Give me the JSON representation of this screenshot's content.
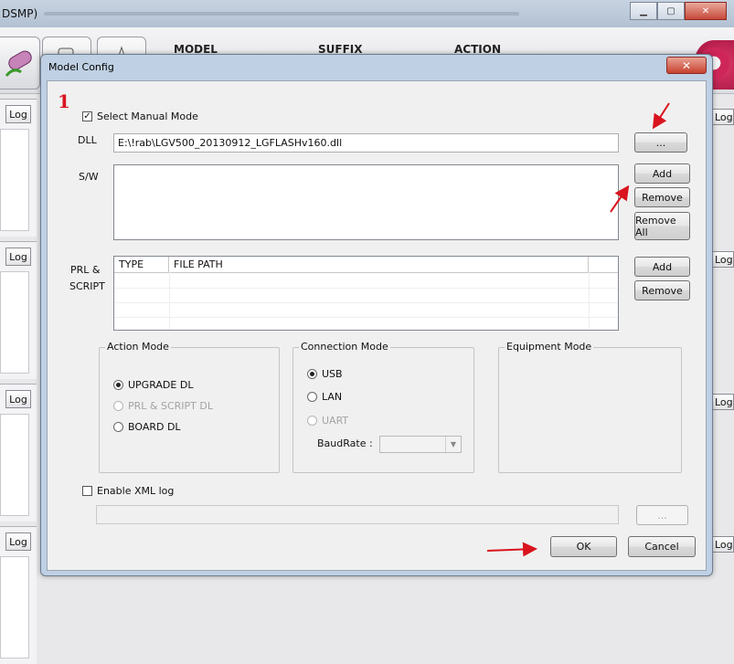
{
  "background": {
    "title": "DSMP)",
    "toolbar_headers": [
      "MODEL",
      "SUFFIX",
      "ACTION"
    ],
    "log_label": "Log"
  },
  "dialog": {
    "title": "Model Config",
    "close_glyph": "✕",
    "annotation_number": "1",
    "manual_mode": {
      "label": "Select Manual Mode",
      "checked": true,
      "check_glyph": "✓"
    },
    "dll": {
      "label": "DLL",
      "value": "E:\\!rab\\LGV500_20130912_LGFLASHv160.dll",
      "browse_label": "..."
    },
    "sw": {
      "label": "S/W",
      "add_label": "Add",
      "remove_label": "Remove",
      "remove_all_label": "Remove All"
    },
    "prl": {
      "label_line1": "PRL   &",
      "label_line2": "SCRIPT",
      "columns": [
        "TYPE",
        "FILE PATH"
      ],
      "add_label": "Add",
      "remove_label": "Remove"
    },
    "action_mode": {
      "title": "Action Mode",
      "options": [
        {
          "label": "UPGRADE DL",
          "selected": true,
          "enabled": true
        },
        {
          "label": "PRL & SCRIPT DL",
          "selected": false,
          "enabled": false
        },
        {
          "label": "BOARD DL",
          "selected": false,
          "enabled": true
        }
      ]
    },
    "connection_mode": {
      "title": "Connection Mode",
      "options": [
        {
          "label": "USB",
          "selected": true,
          "enabled": true
        },
        {
          "label": "LAN",
          "selected": false,
          "enabled": true
        },
        {
          "label": "UART",
          "selected": false,
          "enabled": false
        }
      ],
      "baudrate_label": "BaudRate :",
      "baudrate_value": ""
    },
    "equipment_mode": {
      "title": "Equipment Mode"
    },
    "xml_log": {
      "label": "Enable XML log",
      "checked": false,
      "path_value": "",
      "browse_label": "..."
    },
    "ok_label": "OK",
    "cancel_label": "Cancel"
  },
  "colors": {
    "annotation_red": "#d9141e",
    "dialog_frame": "#bfd0e4",
    "close_red": "#c8412f"
  }
}
